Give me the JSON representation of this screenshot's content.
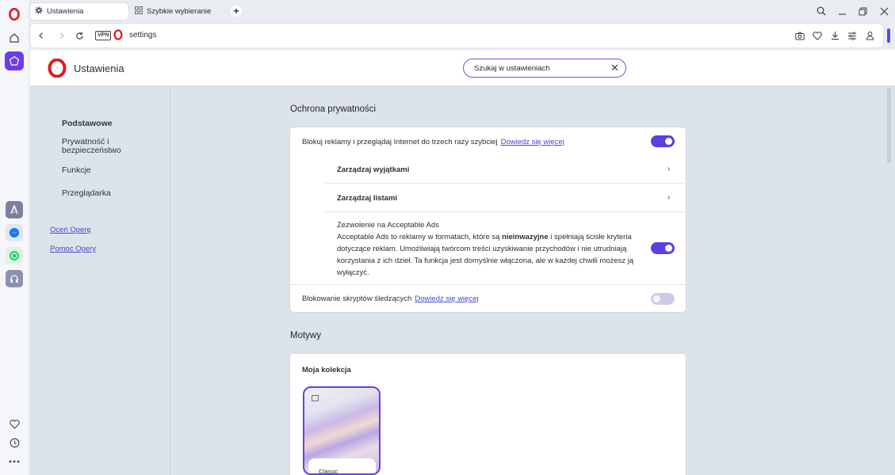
{
  "browser": {
    "tabs": [
      {
        "label": "Ustawienia",
        "icon": "gear-icon",
        "active": true
      },
      {
        "label": "Szybkie wybieranie",
        "icon": "grid-icon",
        "active": false
      }
    ],
    "new_tab_label": "+",
    "vpn_label": "VPN",
    "url": "settings"
  },
  "header": {
    "title": "Ustawienia",
    "search_value": "Szukaj w ustawieniach",
    "search_clear": "✕"
  },
  "nav": {
    "items": [
      "Podstawowe",
      "Prywatność i bezpieczeństwo",
      "Funkcje",
      "Przeglądarka"
    ],
    "links": [
      "Oceń Operę",
      "Pomoc Opery"
    ]
  },
  "privacy": {
    "title": "Ochrona prywatności",
    "block_ads": {
      "label": "Blokuj reklamy i przeglądaj Internet do trzech razy szybciej",
      "link": "Dowiedz się więcej",
      "enabled": true
    },
    "manage_exceptions": "Zarządzaj wyjątkami",
    "manage_lists": "Zarządzaj listami",
    "acceptable_ads": {
      "title": "Zezwolenie na Acceptable Ads",
      "line1_a": "Acceptable Ads to reklamy w formatach, które są ",
      "line1_bold": "nieinwazyjne",
      "line1_b": " i spełniają ścisłe kryteria dotyczące reklam. Umożliwiają twórcom treści uzyskiwanie przychodów i nie utrudniają korzystania z ich dzieł. Ta funkcja jest domyślnie włączona, ale w każdej chwili możesz ją wyłączyć.",
      "enabled": true
    },
    "tracker_block": {
      "label": "Blokowanie skryptów śledzących",
      "link": "Dowiedz się więcej",
      "enabled": false
    }
  },
  "themes": {
    "title": "Motywy",
    "collection_title": "Moja kolekcja",
    "theme_name": "Classic"
  },
  "colors": {
    "accent": "#5b3fe0",
    "brand_red": "#e01a22",
    "link": "#4a46c9"
  }
}
